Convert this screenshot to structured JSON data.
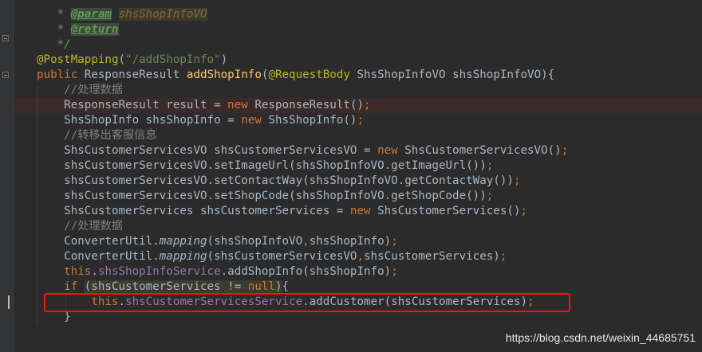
{
  "editor": {
    "lines": [
      {
        "id": "l1",
        "segments": [
          {
            "t": "   * ",
            "c": "doc"
          },
          {
            "t": "@param",
            "c": "tag"
          },
          {
            "t": " ",
            "c": "doc"
          },
          {
            "t": "shsShopInfoVO",
            "c": "param"
          }
        ]
      },
      {
        "id": "l2",
        "segments": [
          {
            "t": "   * ",
            "c": "doc"
          },
          {
            "t": "@return",
            "c": "tag"
          }
        ]
      },
      {
        "id": "l3",
        "segments": [
          {
            "t": "   */",
            "c": "doc"
          }
        ]
      },
      {
        "id": "l4",
        "segments": [
          {
            "t": "@PostMapping",
            "c": "ann"
          },
          {
            "t": "(",
            "c": ""
          },
          {
            "t": "\"/addShopInfo\"",
            "c": "str"
          },
          {
            "t": ")",
            "c": ""
          }
        ]
      },
      {
        "id": "l5",
        "segments": [
          {
            "t": "public ",
            "c": "kw"
          },
          {
            "t": "ResponseResult ",
            "c": ""
          },
          {
            "t": "addShopInfo",
            "c": "mth"
          },
          {
            "t": "(",
            "c": ""
          },
          {
            "t": "@RequestBody ",
            "c": "ann"
          },
          {
            "t": "ShsShopInfoVO shsShopInfoVO){",
            "c": ""
          }
        ]
      },
      {
        "id": "l6",
        "segments": [
          {
            "t": "    //处理数据",
            "c": "cmt"
          }
        ]
      },
      {
        "id": "l7",
        "segments": [
          {
            "t": "    ResponseResult result = ",
            "c": ""
          },
          {
            "t": "new ",
            "c": "kw"
          },
          {
            "t": "ResponseResult()",
            "c": ""
          },
          {
            "t": ";",
            "c": "kw"
          }
        ]
      },
      {
        "id": "l8",
        "segments": [
          {
            "t": "    ShsShopInfo shsShopInfo = ",
            "c": ""
          },
          {
            "t": "new ",
            "c": "kw"
          },
          {
            "t": "ShsShopInfo()",
            "c": ""
          },
          {
            "t": ";",
            "c": "kw"
          }
        ]
      },
      {
        "id": "l9",
        "segments": [
          {
            "t": "    //转移出客服信息",
            "c": "cmt"
          }
        ]
      },
      {
        "id": "l10",
        "segments": [
          {
            "t": "    ShsCustomerServicesVO shsCustomerServicesVO = ",
            "c": ""
          },
          {
            "t": "new ",
            "c": "kw"
          },
          {
            "t": "ShsCustomerServicesVO()",
            "c": ""
          },
          {
            "t": ";",
            "c": "kw"
          }
        ]
      },
      {
        "id": "l11",
        "segments": [
          {
            "t": "    shsCustomerServicesVO.setImageUrl(shsShopInfoVO.getImageUrl())",
            "c": ""
          },
          {
            "t": ";",
            "c": "kw"
          }
        ]
      },
      {
        "id": "l12",
        "segments": [
          {
            "t": "    shsCustomerServicesVO.setContactWay(shsShopInfoVO.getContactWay())",
            "c": ""
          },
          {
            "t": ";",
            "c": "kw"
          }
        ]
      },
      {
        "id": "l13",
        "segments": [
          {
            "t": "    shsCustomerServicesVO.setShopCode(shsShopInfoVO.getShopCode())",
            "c": ""
          },
          {
            "t": ";",
            "c": "kw"
          }
        ]
      },
      {
        "id": "l14",
        "segments": [
          {
            "t": "    ShsCustomerServices shsCustomerServices = ",
            "c": ""
          },
          {
            "t": "new ",
            "c": "kw"
          },
          {
            "t": "ShsCustomerServices()",
            "c": ""
          },
          {
            "t": ";",
            "c": "kw"
          }
        ]
      },
      {
        "id": "l15",
        "segments": [
          {
            "t": "    //处理数据",
            "c": "cmt"
          }
        ]
      },
      {
        "id": "l16",
        "segments": [
          {
            "t": "    ConverterUtil.",
            "c": ""
          },
          {
            "t": "mapping",
            "c": "ital"
          },
          {
            "t": "(shsShopInfoVO",
            "c": ""
          },
          {
            "t": ",",
            "c": "kw"
          },
          {
            "t": "shsShopInfo)",
            "c": ""
          },
          {
            "t": ";",
            "c": "kw"
          }
        ]
      },
      {
        "id": "l17",
        "segments": [
          {
            "t": "    ConverterUtil.",
            "c": ""
          },
          {
            "t": "mapping",
            "c": "ital"
          },
          {
            "t": "(shsCustomerServicesVO",
            "c": ""
          },
          {
            "t": ",",
            "c": "kw"
          },
          {
            "t": "shsCustomerServices)",
            "c": ""
          },
          {
            "t": ";",
            "c": "kw"
          }
        ]
      },
      {
        "id": "l18",
        "segments": [
          {
            "t": "    ",
            "c": ""
          },
          {
            "t": "this",
            "c": "kw"
          },
          {
            "t": ".",
            "c": ""
          },
          {
            "t": "shsShopInfoService",
            "c": "field"
          },
          {
            "t": ".addShopInfo(shsShopInfo)",
            "c": ""
          },
          {
            "t": ";",
            "c": "kw"
          }
        ]
      },
      {
        "id": "l19",
        "segments": [
          {
            "t": "    ",
            "c": ""
          },
          {
            "t": "if ",
            "c": "kw"
          },
          {
            "t": "(",
            "c": "hlbox"
          },
          {
            "t": "shsCustomerServices != ",
            "c": "hlbox"
          },
          {
            "t": "null",
            "c": "kw hlbox"
          },
          {
            "t": ")",
            "c": "hlbox"
          },
          {
            "t": "{",
            "c": ""
          }
        ]
      },
      {
        "id": "l20",
        "segments": [
          {
            "t": "        ",
            "c": ""
          },
          {
            "t": "this",
            "c": "kw"
          },
          {
            "t": ".",
            "c": ""
          },
          {
            "t": "shsCustomerServicesService",
            "c": "field"
          },
          {
            "t": ".addCustomer(shsCustomerServices)",
            "c": ""
          },
          {
            "t": ";",
            "c": "kw"
          }
        ]
      },
      {
        "id": "l21",
        "segments": [
          {
            "t": "    }",
            "c": ""
          }
        ]
      }
    ]
  },
  "watermark": "https://blog.csdn.net/weixin_44685751",
  "colors": {
    "background": "#2b2b2b",
    "keyword": "#cc7832",
    "string": "#6a8759",
    "annotation": "#bbb529",
    "field": "#9876aa",
    "method": "#ffc66d",
    "comment": "#808080",
    "highlight_box": "#ff1010",
    "error_row": "#3a2a2a"
  }
}
